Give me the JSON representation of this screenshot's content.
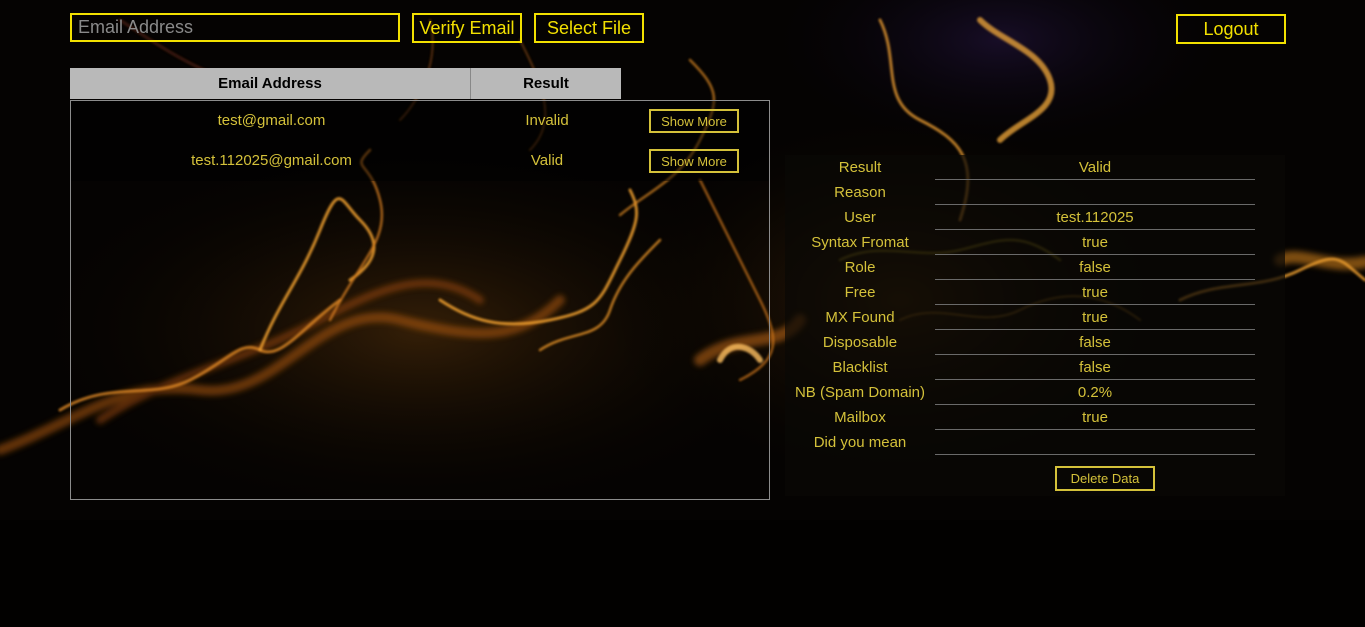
{
  "header": {
    "email_placeholder": "Email Address",
    "verify_label": "Verify Email",
    "select_label": "Select File",
    "logout_label": "Logout"
  },
  "table": {
    "columns": [
      "Email Address",
      "Result"
    ],
    "rows": [
      {
        "email": "test@gmail.com",
        "result": "Invalid",
        "action": "Show More"
      },
      {
        "email": "test.112025@gmail.com",
        "result": "Valid",
        "action": "Show More"
      }
    ]
  },
  "details": {
    "rows": [
      {
        "label": "Result",
        "value": "Valid"
      },
      {
        "label": "Reason",
        "value": ""
      },
      {
        "label": "User",
        "value": "test.112025"
      },
      {
        "label": "Syntax Fromat",
        "value": "true"
      },
      {
        "label": "Role",
        "value": "false"
      },
      {
        "label": "Free",
        "value": "true"
      },
      {
        "label": "MX Found",
        "value": "true"
      },
      {
        "label": "Disposable",
        "value": "false"
      },
      {
        "label": "Blacklist",
        "value": "false"
      },
      {
        "label": "NB (Spam Domain)",
        "value": "0.2%"
      },
      {
        "label": "Mailbox",
        "value": "true"
      },
      {
        "label": "Did you mean",
        "value": ""
      }
    ],
    "delete_label": "Delete Data"
  },
  "colors": {
    "accent": "#f2e000",
    "text": "#d4c13a",
    "header_bg": "#b9b9b9"
  }
}
